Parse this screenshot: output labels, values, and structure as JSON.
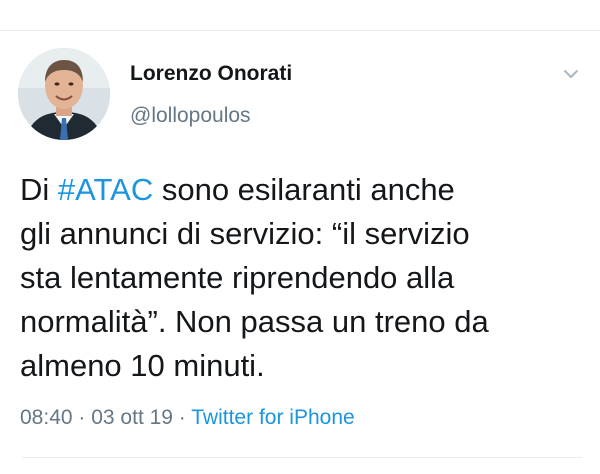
{
  "tweet": {
    "author": {
      "name": "Lorenzo Onorati",
      "handle": "@lollopoulos"
    },
    "text": {
      "prefix": "Di ",
      "hashtag": "#ATAC",
      "body": " sono esilaranti anche\ngli annunci di servizio: “il servizio\nsta lentamente riprendendo alla\nnormalità”. Non passa un treno da\nalmeno 10 minuti."
    },
    "meta": {
      "time": "08:40",
      "separator1": " · ",
      "date": "03 ott 19",
      "separator2": " · ",
      "source": "Twitter for iPhone"
    },
    "icons": {
      "menu": "chevron-down-icon"
    },
    "colors": {
      "link": "#1b95e0",
      "secondary_text": "#657786",
      "primary_text": "#14171a",
      "divider": "#e6ecf0"
    }
  }
}
